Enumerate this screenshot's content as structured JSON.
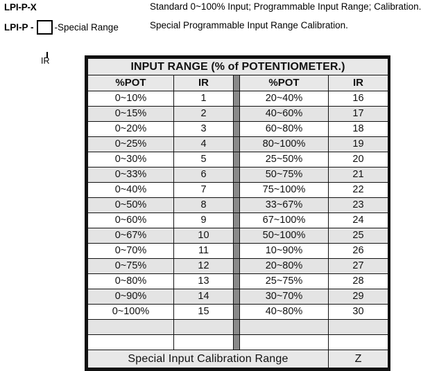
{
  "legend": {
    "rows": [
      {
        "code": "LPI-P-X",
        "description": "Standard 0~100% Input; Programmable Input Range; Calibration."
      },
      {
        "code_prefix": "LPI-P -",
        "box_label": "IR",
        "suffix": "-Special Range",
        "description": "Special Programmable Input Range Calibration."
      }
    ]
  },
  "table": {
    "title": "INPUT RANGE (% of POTENTIOMETER.)",
    "headers": {
      "pot_left": "%POT",
      "ir_left": "IR",
      "pot_right": "%POT",
      "ir_right": "IR"
    },
    "rows": [
      {
        "pot_left": "0~10%",
        "ir_left": "1",
        "pot_right": "20~40%",
        "ir_right": "16"
      },
      {
        "pot_left": "0~15%",
        "ir_left": "2",
        "pot_right": "40~60%",
        "ir_right": "17"
      },
      {
        "pot_left": "0~20%",
        "ir_left": "3",
        "pot_right": "60~80%",
        "ir_right": "18"
      },
      {
        "pot_left": "0~25%",
        "ir_left": "4",
        "pot_right": "80~100%",
        "ir_right": "19"
      },
      {
        "pot_left": "0~30%",
        "ir_left": "5",
        "pot_right": "25~50%",
        "ir_right": "20"
      },
      {
        "pot_left": "0~33%",
        "ir_left": "6",
        "pot_right": "50~75%",
        "ir_right": "21"
      },
      {
        "pot_left": "0~40%",
        "ir_left": "7",
        "pot_right": "75~100%",
        "ir_right": "22"
      },
      {
        "pot_left": "0~50%",
        "ir_left": "8",
        "pot_right": "33~67%",
        "ir_right": "23"
      },
      {
        "pot_left": "0~60%",
        "ir_left": "9",
        "pot_right": "67~100%",
        "ir_right": "24"
      },
      {
        "pot_left": "0~67%",
        "ir_left": "10",
        "pot_right": "50~100%",
        "ir_right": "25"
      },
      {
        "pot_left": "0~70%",
        "ir_left": "11",
        "pot_right": "10~90%",
        "ir_right": "26"
      },
      {
        "pot_left": "0~75%",
        "ir_left": "12",
        "pot_right": "20~80%",
        "ir_right": "27"
      },
      {
        "pot_left": "0~80%",
        "ir_left": "13",
        "pot_right": "25~75%",
        "ir_right": "28"
      },
      {
        "pot_left": "0~90%",
        "ir_left": "14",
        "pot_right": "30~70%",
        "ir_right": "29"
      },
      {
        "pot_left": "0~100%",
        "ir_left": "15",
        "pot_right": "40~80%",
        "ir_right": "30"
      },
      {
        "pot_left": "",
        "ir_left": "",
        "pot_right": "",
        "ir_right": ""
      },
      {
        "pot_left": "",
        "ir_left": "",
        "pot_right": "",
        "ir_right": ""
      }
    ],
    "footer": {
      "label": "Special Input Calibration Range",
      "code": "Z"
    }
  },
  "colors": {
    "border": "#111111",
    "shade": "#e4e4e4",
    "header_shade": "#e8e8e8",
    "divider": "#8a8a8a"
  }
}
